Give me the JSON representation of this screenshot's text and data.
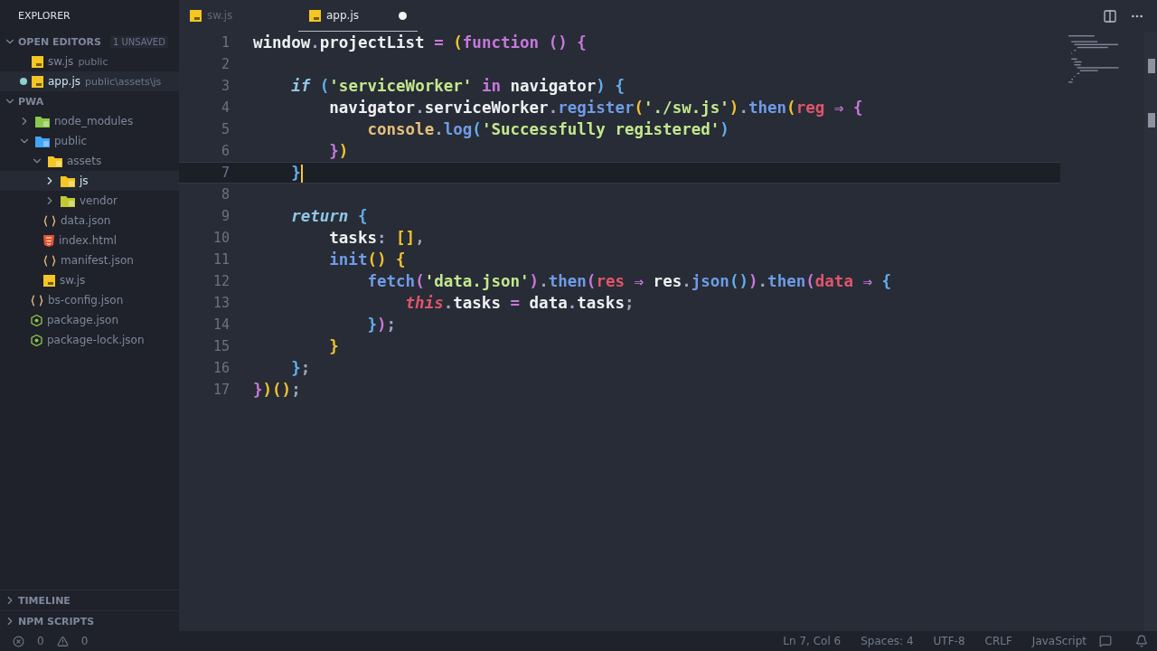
{
  "sidebar": {
    "title": "EXPLORER",
    "open_editors": {
      "title": "OPEN EDITORS",
      "expanded": true,
      "badge": "1 UNSAVED",
      "items": [
        {
          "name": "sw.js",
          "path": "public",
          "kind": "js",
          "modified": false,
          "selected": false
        },
        {
          "name": "app.js",
          "path": "public\\assets\\js",
          "kind": "js",
          "modified": true,
          "selected": true
        }
      ]
    },
    "project": {
      "title": "PWA",
      "expanded": true,
      "tree": [
        {
          "name": "node_modules",
          "kind": "folder-node",
          "expanded": false,
          "selected": false
        },
        {
          "name": "public",
          "kind": "folder-public",
          "expanded": true,
          "selected": false,
          "children": [
            {
              "name": "assets",
              "kind": "folder-assets",
              "expanded": true,
              "selected": false,
              "children": [
                {
                  "name": "js",
                  "kind": "folder-js",
                  "expanded": false,
                  "selected": true
                },
                {
                  "name": "vendor",
                  "kind": "folder-vendor",
                  "expanded": false,
                  "selected": false
                }
              ]
            },
            {
              "name": "data.json",
              "kind": "json",
              "selected": false
            },
            {
              "name": "index.html",
              "kind": "html",
              "selected": false
            },
            {
              "name": "manifest.json",
              "kind": "json",
              "selected": false
            },
            {
              "name": "sw.js",
              "kind": "js",
              "selected": false
            }
          ]
        },
        {
          "name": "bs-config.json",
          "kind": "json",
          "selected": false
        },
        {
          "name": "package.json",
          "kind": "node",
          "selected": false
        },
        {
          "name": "package-lock.json",
          "kind": "node",
          "selected": false
        }
      ]
    },
    "panels": [
      {
        "title": "TIMELINE",
        "expanded": false
      },
      {
        "title": "NPM SCRIPTS",
        "expanded": false
      }
    ]
  },
  "tabs": [
    {
      "name": "sw.js",
      "kind": "js",
      "selected": false,
      "modified": false
    },
    {
      "name": "app.js",
      "kind": "js",
      "selected": true,
      "modified": true
    }
  ],
  "editor": {
    "lines": [
      {
        "number": "1",
        "current": false,
        "tokens": [
          {
            "text": "window",
            "kind": "var"
          },
          {
            "text": ".",
            "kind": "punct"
          },
          {
            "text": "projectList ",
            "kind": "var"
          },
          {
            "text": "= ",
            "kind": "op"
          },
          {
            "text": "(",
            "kind": "b1"
          },
          {
            "text": "function ",
            "kind": "fnkw"
          },
          {
            "text": "() {",
            "kind": "b2"
          }
        ]
      },
      {
        "number": "2",
        "current": false
      },
      {
        "number": "3",
        "current": false,
        "tokens": [
          {
            "text": "    if ",
            "kind": "kw"
          },
          {
            "text": "(",
            "kind": "b3"
          },
          {
            "text": "'serviceWorker' ",
            "kind": "str"
          },
          {
            "text": "in ",
            "kind": "op"
          },
          {
            "text": "navigator",
            "kind": "var"
          },
          {
            "text": ") {",
            "kind": "b3"
          }
        ]
      },
      {
        "number": "4",
        "current": false,
        "tokens": [
          {
            "text": "        navigator",
            "kind": "var"
          },
          {
            "text": ".",
            "kind": "punct"
          },
          {
            "text": "serviceWorker",
            "kind": "var"
          },
          {
            "text": ".",
            "kind": "punct"
          },
          {
            "text": "register",
            "kind": "fn"
          },
          {
            "text": "(",
            "kind": "b1"
          },
          {
            "text": "'./sw.js'",
            "kind": "str"
          },
          {
            "text": ")",
            "kind": "b1"
          },
          {
            "text": ".",
            "kind": "punct"
          },
          {
            "text": "then",
            "kind": "fn"
          },
          {
            "text": "(",
            "kind": "b1"
          },
          {
            "text": "reg ",
            "kind": "param"
          },
          {
            "text": "⇒ ",
            "kind": "op"
          },
          {
            "text": "{",
            "kind": "b2"
          }
        ]
      },
      {
        "number": "5",
        "current": false,
        "tokens": [
          {
            "text": "            console",
            "kind": "obj"
          },
          {
            "text": ".",
            "kind": "punct"
          },
          {
            "text": "log",
            "kind": "fn"
          },
          {
            "text": "(",
            "kind": "b3"
          },
          {
            "text": "'Successfully registered'",
            "kind": "str"
          },
          {
            "text": ")",
            "kind": "b3"
          }
        ]
      },
      {
        "number": "6",
        "current": false,
        "tokens": [
          {
            "text": "        }",
            "kind": "b2"
          },
          {
            "text": ")",
            "kind": "b1"
          }
        ]
      },
      {
        "number": "7",
        "current": true,
        "tokens": [
          {
            "text": "    }",
            "kind": "b3"
          }
        ]
      },
      {
        "number": "8",
        "current": false
      },
      {
        "number": "9",
        "current": false,
        "tokens": [
          {
            "text": "    return ",
            "kind": "kw"
          },
          {
            "text": "{",
            "kind": "b3"
          }
        ]
      },
      {
        "number": "10",
        "current": false,
        "tokens": [
          {
            "text": "        tasks",
            "kind": "var"
          },
          {
            "text": ": ",
            "kind": "punct"
          },
          {
            "text": "[]",
            "kind": "b1"
          },
          {
            "text": ",",
            "kind": "punct"
          }
        ]
      },
      {
        "number": "11",
        "current": false,
        "tokens": [
          {
            "text": "        init",
            "kind": "fn"
          },
          {
            "text": "() {",
            "kind": "b1"
          }
        ]
      },
      {
        "number": "12",
        "current": false,
        "tokens": [
          {
            "text": "            fetch",
            "kind": "fn"
          },
          {
            "text": "(",
            "kind": "b2"
          },
          {
            "text": "'data.json'",
            "kind": "str"
          },
          {
            "text": ")",
            "kind": "b2"
          },
          {
            "text": ".",
            "kind": "punct"
          },
          {
            "text": "then",
            "kind": "fn"
          },
          {
            "text": "(",
            "kind": "b2"
          },
          {
            "text": "res ",
            "kind": "param"
          },
          {
            "text": "⇒ ",
            "kind": "op"
          },
          {
            "text": "res",
            "kind": "var"
          },
          {
            "text": ".",
            "kind": "punct"
          },
          {
            "text": "json",
            "kind": "fn"
          },
          {
            "text": "()",
            "kind": "b3"
          },
          {
            "text": ")",
            "kind": "b2"
          },
          {
            "text": ".",
            "kind": "punct"
          },
          {
            "text": "then",
            "kind": "fn"
          },
          {
            "text": "(",
            "kind": "b2"
          },
          {
            "text": "data ",
            "kind": "param"
          },
          {
            "text": "⇒ ",
            "kind": "op"
          },
          {
            "text": "{",
            "kind": "b3"
          }
        ]
      },
      {
        "number": "13",
        "current": false,
        "tokens": [
          {
            "text": "                this",
            "kind": "this"
          },
          {
            "text": ".",
            "kind": "punct"
          },
          {
            "text": "tasks ",
            "kind": "var"
          },
          {
            "text": "= ",
            "kind": "op"
          },
          {
            "text": "data",
            "kind": "var"
          },
          {
            "text": ".",
            "kind": "punct"
          },
          {
            "text": "tasks",
            "kind": "var"
          },
          {
            "text": ";",
            "kind": "punct"
          }
        ]
      },
      {
        "number": "14",
        "current": false,
        "tokens": [
          {
            "text": "            }",
            "kind": "b3"
          },
          {
            "text": ")",
            "kind": "b2"
          },
          {
            "text": ";",
            "kind": "punct"
          }
        ]
      },
      {
        "number": "15",
        "current": false,
        "tokens": [
          {
            "text": "        }",
            "kind": "b1"
          }
        ]
      },
      {
        "number": "16",
        "current": false,
        "tokens": [
          {
            "text": "    }",
            "kind": "b3"
          },
          {
            "text": ";",
            "kind": "punct"
          }
        ]
      },
      {
        "number": "17",
        "current": false,
        "tokens": [
          {
            "text": "}",
            "kind": "b2"
          },
          {
            "text": ")()",
            "kind": "b1"
          },
          {
            "text": ";",
            "kind": "punct"
          }
        ]
      }
    ]
  },
  "status_bar": {
    "errors": "0",
    "warnings": "0",
    "items": [
      "Ln 7, Col 6",
      "Spaces: 4",
      "UTF-8",
      "CRLF",
      "JavaScript"
    ]
  }
}
